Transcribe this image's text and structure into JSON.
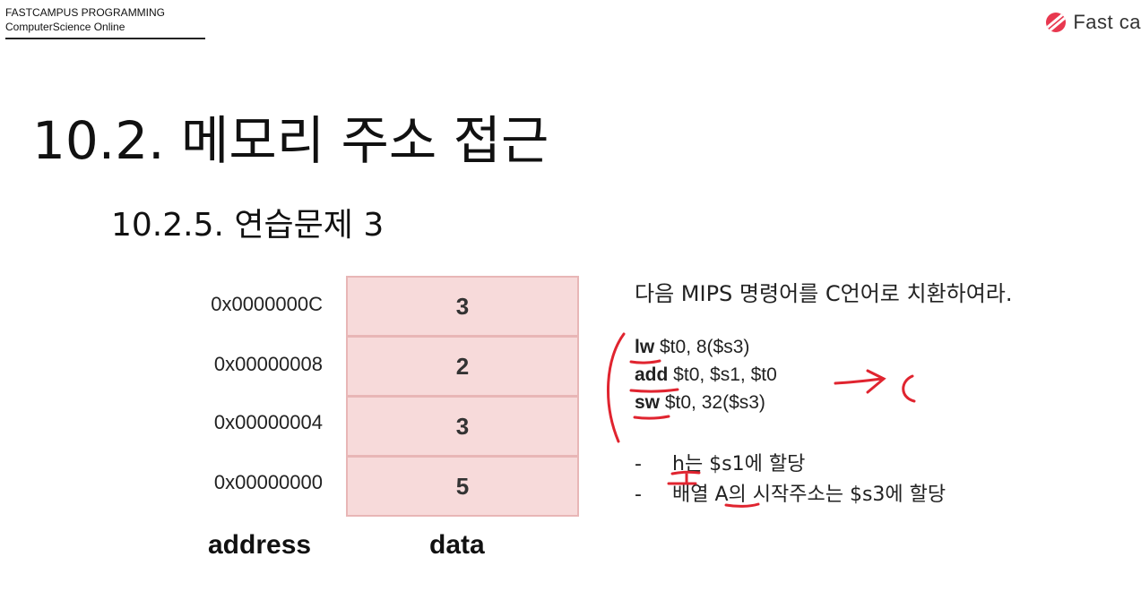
{
  "header": {
    "line1": "FASTCAMPUS PROGRAMMING",
    "line2": "ComputerScience Online",
    "brand": "Fast ca",
    "brand_icon": "fastcampus-logo-icon"
  },
  "slide": {
    "title": "10.2. 메모리 주소 접근",
    "subtitle": "10.2.5. 연습문제 3"
  },
  "memory": {
    "rows": [
      {
        "address": "0x0000000C",
        "data": "3"
      },
      {
        "address": "0x00000008",
        "data": "2"
      },
      {
        "address": "0x00000004",
        "data": "3"
      },
      {
        "address": "0x00000000",
        "data": "5"
      }
    ],
    "address_label": "address",
    "data_label": "data"
  },
  "problem": {
    "prompt": "다음 MIPS 명령어를 C언어로 치환하여라.",
    "code": [
      {
        "op": "lw",
        "args": " $t0, 8($s3)"
      },
      {
        "op": "add",
        "args": " $t0, $s1, $t0"
      },
      {
        "op": "sw",
        "args": " $t0, 32($s3)"
      }
    ],
    "notes": [
      {
        "dash": "-",
        "text": "h는 $s1에 할당"
      },
      {
        "dash": "-",
        "text": "배열 A의 시작주소는 $s3에 할당"
      }
    ]
  },
  "colors": {
    "cell_fill": "#f7dada",
    "cell_border": "#e8b6b6",
    "annotation_red": "#e0242f",
    "brand_red": "#e8384f"
  }
}
